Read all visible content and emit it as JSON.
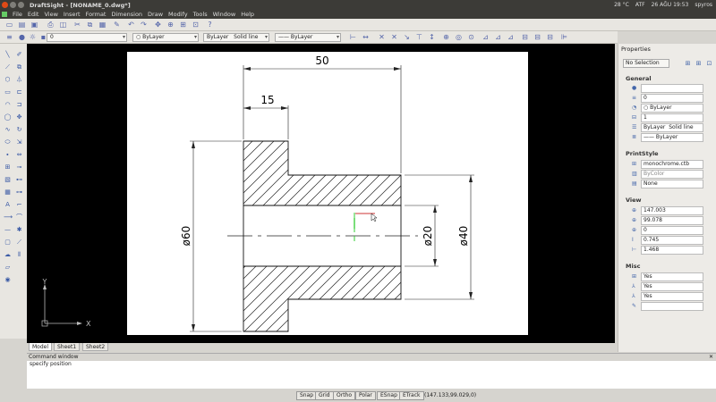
{
  "window": {
    "title": "DraftSight - [NONAME_0.dwg*]",
    "tray": [
      "28 °C",
      "ATF",
      "26 AĞU 19:53",
      "spyros"
    ]
  },
  "menu": [
    "File",
    "Edit",
    "View",
    "Insert",
    "Format",
    "Dimension",
    "Draw",
    "Modify",
    "Tools",
    "Window",
    "Help"
  ],
  "toolbar": {
    "layer": "0",
    "color": "ByLayer",
    "linetype_label": "ByLayer",
    "linetype_value": "Solid line",
    "lineweight": "ByLayer"
  },
  "drawing": {
    "dims": {
      "overall": "50",
      "step": "15",
      "dia60": "ø60",
      "dia20": "ø20",
      "dia40": "ø40"
    },
    "ucs": {
      "x": "X",
      "y": "Y"
    }
  },
  "properties": {
    "title": "Properties",
    "selection": "No Selection",
    "general": {
      "title": "General",
      "color": "",
      "layer": "0",
      "linestyle": "ByLayer",
      "scale": "1",
      "lw_label": "ByLayer",
      "lw_value": "Solid line",
      "lineweight": "ByLayer"
    },
    "printstyle": {
      "title": "PrintStyle",
      "table": "monochrome.ctb",
      "style": "ByColor",
      "mode": "None"
    },
    "view": {
      "title": "View",
      "cx": "147.003",
      "cy": "99.078",
      "cz": "0",
      "height": "0.745",
      "width": "1.468"
    },
    "misc": {
      "title": "Misc",
      "a": "Yes",
      "b": "Yes",
      "c": "Yes"
    }
  },
  "tabs": [
    "Model",
    "Sheet1",
    "Sheet2"
  ],
  "command": {
    "title": "Command window",
    "text": "specify position"
  },
  "status": {
    "buttons": [
      "Snap",
      "Grid",
      "Ortho",
      "Polar",
      "ESnap",
      "ETrack"
    ],
    "coords": "(147.133,99.029,0)"
  }
}
